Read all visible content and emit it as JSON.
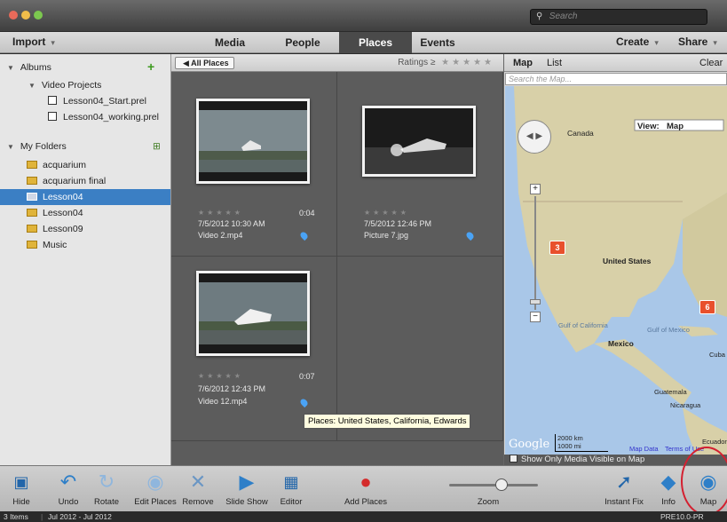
{
  "search": {
    "placeholder": "Search"
  },
  "menu": {
    "import": "Import",
    "tabs": [
      "Media",
      "People",
      "Places",
      "Events"
    ],
    "create": "Create",
    "share": "Share"
  },
  "sidebar": {
    "albums_label": "Albums",
    "video_projects": "Video Projects",
    "projects": [
      "Lesson04_Start.prel",
      "Lesson04_working.prel"
    ],
    "my_folders_label": "My Folders",
    "folders": [
      "acquarium",
      "acquarium final",
      "Lesson04",
      "Lesson04",
      "Lesson09",
      "Music"
    ]
  },
  "center": {
    "crumb": "All Places",
    "ratings_label": "Ratings",
    "ratings_op": "≥",
    "items": [
      {
        "date": "7/5/2012 10:30 AM",
        "name": "Video 2.mp4",
        "duration": "0:04"
      },
      {
        "date": "7/5/2012 12:46 PM",
        "name": "Picture 7.jpg",
        "duration": ""
      },
      {
        "date": "7/6/2012 12:43 PM",
        "name": "Video 12.mp4",
        "duration": "0:07"
      }
    ],
    "tooltip": "Places: United States, California, Edwards"
  },
  "map": {
    "tab_map": "Map",
    "tab_list": "List",
    "clear": "Clear",
    "search_placeholder": "Search the Map...",
    "view_label": "View:",
    "view_value": "Map",
    "labels": {
      "canada": "Canada",
      "us": "United States",
      "mexico": "Mexico",
      "guatemala": "Guatemala",
      "nicaragua": "Nicaragua",
      "cuba": "Cuba",
      "gulf": "Gulf of Mexico",
      "gulf_cal": "Gulf of California",
      "ecuador": "Ecuador"
    },
    "markers": [
      "3",
      "6"
    ],
    "scale_km": "2000 km",
    "scale_mi": "1000 mi",
    "map_data": "Map Data",
    "terms": "Terms of Use",
    "google": "Google",
    "show_only": "Show Only Media Visible on Map",
    "colors": {
      "ocean": "#a9c7e8",
      "land": "#d8d0a8",
      "marker": "#e8502c"
    }
  },
  "toolbar": {
    "hide": "Hide",
    "undo": "Undo",
    "rotate": "Rotate",
    "edit_places": "Edit Places",
    "remove": "Remove",
    "slide_show": "Slide Show",
    "editor": "Editor",
    "add_places": "Add Places",
    "zoom": "Zoom",
    "instant_fix": "Instant Fix",
    "info": "Info",
    "map": "Map"
  },
  "status": {
    "count": "3 Items",
    "range": "Jul 2012 - Jul 2012",
    "version": "PRE10.0-PR"
  }
}
